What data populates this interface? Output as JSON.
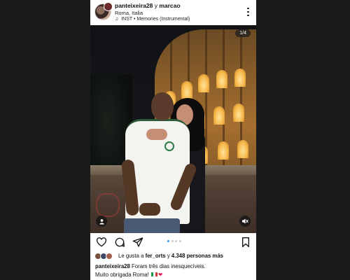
{
  "post": {
    "header": {
      "username": "panteixeira28",
      "connector": "y",
      "collaborator": "marcao",
      "location": "Roma, Italia",
      "audio_artist": "INST",
      "audio_separator": "•",
      "audio_title": "Memories (Instrumental)"
    },
    "media": {
      "counter": "1/4",
      "carousel_total": 4,
      "carousel_current": 1
    },
    "likes": {
      "prefix": "Le gusta a",
      "liker": "fer_orts",
      "middle": "y",
      "others": "4.348 personas más"
    },
    "caption": {
      "username": "panteixeira28",
      "line1": "Foram três dias inesquecíveis.",
      "line2": "Muito obrigada Roma!",
      "emojis": [
        "italy-flag",
        "red-heart"
      ]
    },
    "colors": {
      "active_dot": "#3897f0",
      "inactive_dot": "#c7c7c7",
      "heart": "#e0245e"
    }
  }
}
